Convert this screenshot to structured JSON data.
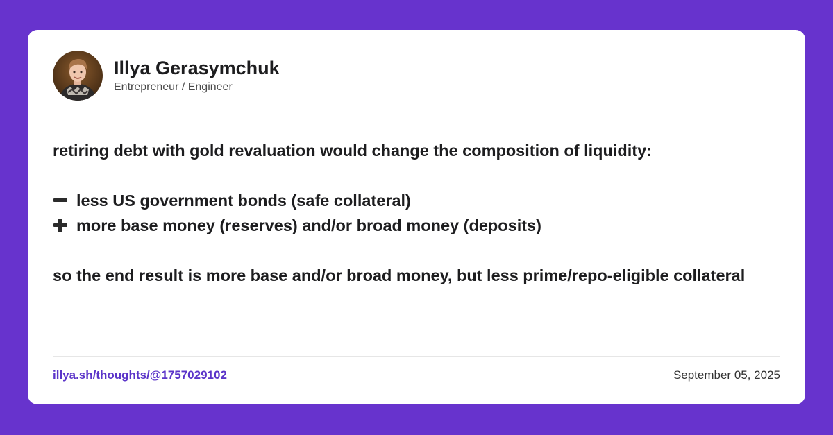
{
  "author": {
    "name": "Illya Gerasymchuk",
    "title": "Entrepreneur / Engineer",
    "avatar_icon": "avatar-photo"
  },
  "post": {
    "intro": "retiring debt with gold revaluation would change the composition of liquidity:",
    "bullets": [
      {
        "icon": "minus-icon",
        "text": "less US government bonds (safe collateral)"
      },
      {
        "icon": "plus-icon",
        "text": "more base money (reserves) and/or broad money (deposits)"
      }
    ],
    "conclusion": "so the end result is more base and/or broad money, but less prime/repo-eligible collateral"
  },
  "footer": {
    "link": "illya.sh/thoughts/@1757029102",
    "date": "September 05, 2025"
  },
  "colors": {
    "background": "#6733cd",
    "card": "#ffffff",
    "link": "#5b34c9"
  }
}
